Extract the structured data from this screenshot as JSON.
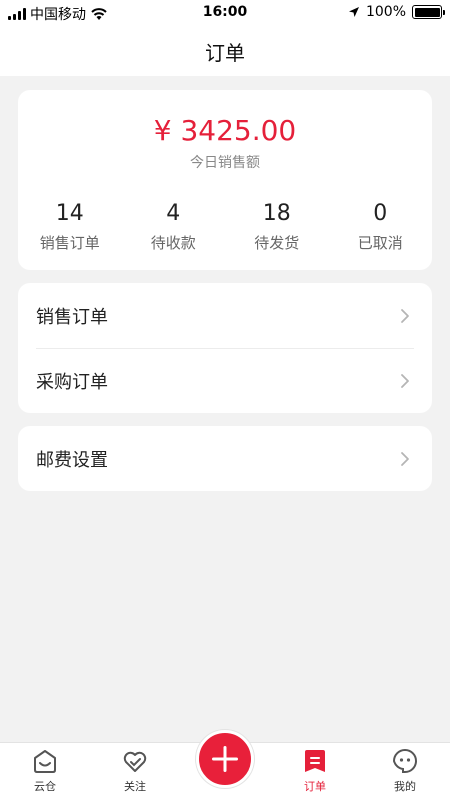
{
  "status_bar": {
    "carrier": "中国移动",
    "time": "16:00",
    "battery": "100%",
    "battery_level": 1.0
  },
  "nav": {
    "title": "订单"
  },
  "summary": {
    "amount": "¥ 3425.00",
    "amount_label": "今日销售额",
    "stats": [
      {
        "value": "14",
        "label": "销售订单"
      },
      {
        "value": "4",
        "label": "待收款"
      },
      {
        "value": "18",
        "label": "待发货"
      },
      {
        "value": "0",
        "label": "已取消"
      }
    ]
  },
  "menu": {
    "sales_orders": "销售订单",
    "purchase_orders": "采购订单",
    "shipping_settings": "邮费设置"
  },
  "tabs": [
    {
      "label": "云仓",
      "icon": "warehouse-icon"
    },
    {
      "label": "关注",
      "icon": "heart-icon"
    },
    {
      "label": "订单",
      "icon": "order-icon"
    },
    {
      "label": "我的",
      "icon": "profile-icon"
    }
  ],
  "colors": {
    "accent": "#e5203a",
    "background": "#f2f2f2"
  }
}
